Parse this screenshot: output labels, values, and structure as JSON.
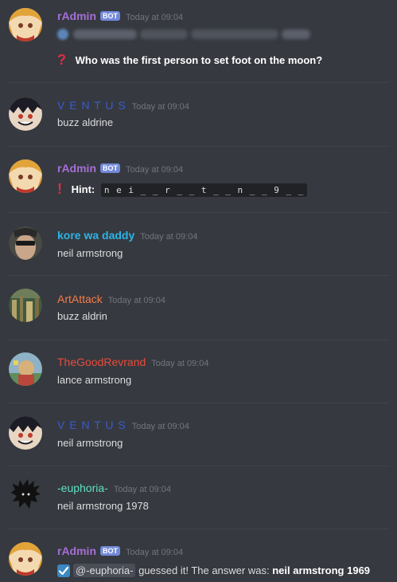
{
  "colors": {
    "background": "#36393f",
    "radmin": "#a56fd6",
    "ventus": "#3a5bd1",
    "kore": "#2ab5e8",
    "artattack": "#f47b4a",
    "thegoodrevrand": "#e74c3c",
    "euphoria": "#5fe1c4",
    "bot_badge": "#7289da",
    "timestamp": "#72767d"
  },
  "messages": [
    {
      "author": "rAdmin",
      "bot_label": "BOT",
      "timestamp": "Today at 09:04",
      "question_icon": "?",
      "text": "Who was the first person to set foot on the moon?"
    },
    {
      "author": "V E N T U S",
      "timestamp": "Today at 09:04",
      "text": "buzz aldrine"
    },
    {
      "author": "rAdmin",
      "bot_label": "BOT",
      "timestamp": "Today at 09:04",
      "hint_icon": "!",
      "hint_label": "Hint:",
      "hint_value": "n e i _   _ r _ _ t _ _ n _   _ 9 _ _"
    },
    {
      "author": "kore wa daddy",
      "timestamp": "Today at 09:04",
      "text": "neil armstrong"
    },
    {
      "author": "ArtAttack",
      "timestamp": "Today at 09:04",
      "text": "buzz aldrin"
    },
    {
      "author": "TheGoodRevrand",
      "timestamp": "Today at 09:04",
      "text": "lance armstrong"
    },
    {
      "author": "V E N T U S",
      "timestamp": "Today at 09:04",
      "text": "neil armstrong"
    },
    {
      "author": "-euphoria-",
      "timestamp": "Today at 09:04",
      "text": "neil armstrong 1978"
    },
    {
      "author": "rAdmin",
      "bot_label": "BOT",
      "timestamp": "Today at 09:04",
      "mention": "@-euphoria-",
      "text": " guessed it! The answer was: ",
      "answer": "neil armstrong 1969"
    }
  ]
}
